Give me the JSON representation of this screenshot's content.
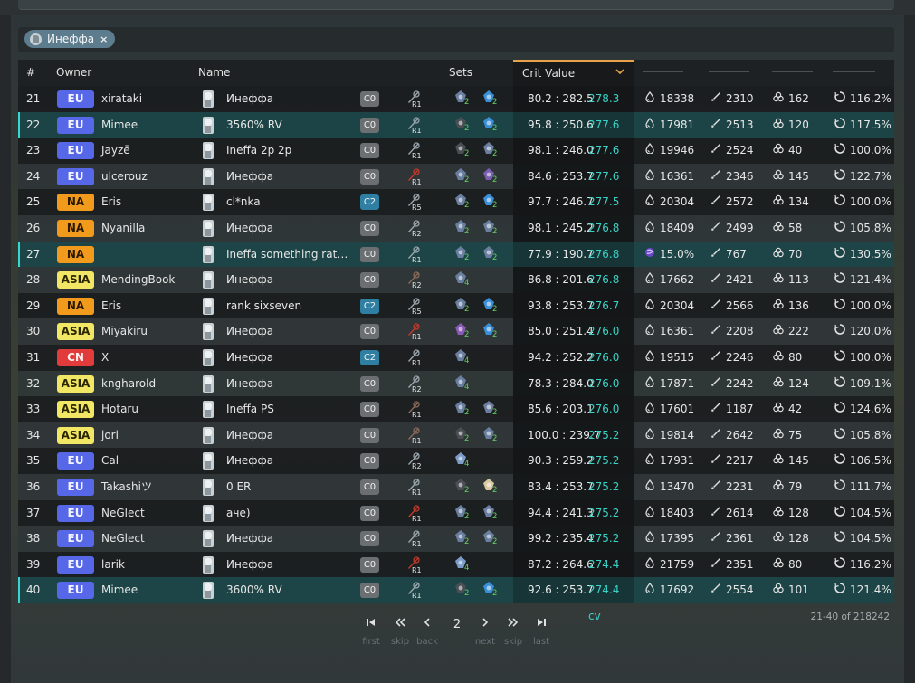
{
  "filter": {
    "chip_label": "Инеффа",
    "chip_close": "×"
  },
  "columns": {
    "rank": "#",
    "owner": "Owner",
    "name": "Name",
    "sets": "Sets",
    "crit": "Crit Value"
  },
  "rows": [
    {
      "rank": "21",
      "region": "EU",
      "owner": "xirataki",
      "name": "Инеффа",
      "cons": "C0",
      "refine": "R1",
      "wcolor": "#9aa6ad",
      "sets": [
        {
          "c": "#6a7fa0",
          "n": "2"
        },
        {
          "c": "#3a8fd8",
          "n": "2"
        }
      ],
      "ratio": "80.2 : 282.5",
      "cv": "278.3 cv",
      "s1": "18338",
      "s1icon": "hp",
      "s2": "2310",
      "s3": "162",
      "s4": "116.2%",
      "hl": false
    },
    {
      "rank": "22",
      "region": "EU",
      "owner": "Mimee",
      "name": "3560% RV",
      "cons": "C0",
      "refine": "R1",
      "wcolor": "#9aa6ad",
      "sets": [
        {
          "c": "#4b4f55",
          "n": "2"
        },
        {
          "c": "#3a8fd8",
          "n": "2"
        }
      ],
      "ratio": "95.8 : 250.6",
      "cv": "277.6 cv",
      "s1": "17981",
      "s1icon": "hp",
      "s2": "2513",
      "s3": "120",
      "s4": "117.5%",
      "hl": true
    },
    {
      "rank": "23",
      "region": "EU",
      "owner": "Jayzē",
      "name": "Ineffa 2p 2p",
      "cons": "C0",
      "refine": "R1",
      "wcolor": "#9aa6ad",
      "sets": [
        {
          "c": "#4b4f55",
          "n": "2"
        },
        {
          "c": "#6a7fa0",
          "n": "2"
        }
      ],
      "ratio": "98.1 : 246.0",
      "cv": "277.6 cv",
      "s1": "19946",
      "s1icon": "hp",
      "s2": "2524",
      "s3": "40",
      "s4": "100.0%",
      "hl": false
    },
    {
      "rank": "24",
      "region": "EU",
      "owner": "ulcerouz",
      "name": "Инеффа",
      "cons": "C0",
      "refine": "R1",
      "wcolor": "#c0392b",
      "sets": [
        {
          "c": "#6a7fa0",
          "n": "2"
        },
        {
          "c": "#7a5fb0",
          "n": "2"
        }
      ],
      "ratio": "84.6 : 253.7",
      "cv": "277.6 cv",
      "s1": "16361",
      "s1icon": "hp",
      "s2": "2346",
      "s3": "145",
      "s4": "122.7%",
      "hl": false
    },
    {
      "rank": "25",
      "region": "NA",
      "owner": "Eris",
      "name": "cl*nka",
      "cons": "C2",
      "refine": "R5",
      "wcolor": "#9aa6ad",
      "sets": [
        {
          "c": "#6a7fa0",
          "n": "2"
        },
        {
          "c": "#3a8fd8",
          "n": "2"
        }
      ],
      "ratio": "97.7 : 246.7",
      "cv": "277.5 cv",
      "s1": "20304",
      "s1icon": "hp",
      "s2": "2572",
      "s3": "134",
      "s4": "100.0%",
      "hl": false
    },
    {
      "rank": "26",
      "region": "NA",
      "owner": "Nyanilla",
      "name": "Инеффа",
      "cons": "C0",
      "refine": "R2",
      "wcolor": "#9aa6ad",
      "sets": [
        {
          "c": "#6a7fa0",
          "n": "2"
        },
        {
          "c": "#6a7fa0",
          "n": "2"
        }
      ],
      "ratio": "98.1 : 245.2",
      "cv": "276.8 cv",
      "s1": "18409",
      "s1icon": "hp",
      "s2": "2499",
      "s3": "58",
      "s4": "105.8%",
      "hl": false
    },
    {
      "rank": "27",
      "region": "NA",
      "owner": "",
      "name": "Ineffa something rather...",
      "cons": "C0",
      "refine": "R1",
      "wcolor": "#9aa6ad",
      "sets": [
        {
          "c": "#6a7fa0",
          "n": "2"
        },
        {
          "c": "#6a7fa0",
          "n": "2"
        }
      ],
      "ratio": "77.9 : 190.7",
      "cv": "276.8 cv",
      "s1": "15.0%",
      "s1icon": "electro",
      "s2": "767",
      "s3": "70",
      "s4": "130.5%",
      "hl": true
    },
    {
      "rank": "28",
      "region": "ASIA",
      "owner": "MendingBook",
      "name": "Инеффа",
      "cons": "C0",
      "refine": "R2",
      "wcolor": "#8a6a5a",
      "sets": [
        {
          "c": "#6a7fa0",
          "n": "4"
        }
      ],
      "ratio": "86.8 : 201.6",
      "cv": "276.8 cv",
      "s1": "17662",
      "s1icon": "hp",
      "s2": "2421",
      "s3": "113",
      "s4": "121.4%",
      "hl": false
    },
    {
      "rank": "29",
      "region": "NA",
      "owner": "Eris",
      "name": "rank sixseven",
      "cons": "C2",
      "refine": "R5",
      "wcolor": "#9aa6ad",
      "sets": [
        {
          "c": "#6a7fa0",
          "n": "2"
        },
        {
          "c": "#3a8fd8",
          "n": "2"
        }
      ],
      "ratio": "93.8 : 253.7",
      "cv": "276.7 cv",
      "s1": "20304",
      "s1icon": "hp",
      "s2": "2566",
      "s3": "136",
      "s4": "100.0%",
      "hl": false
    },
    {
      "rank": "30",
      "region": "ASIA",
      "owner": "Miyakiru",
      "name": "Инеффа",
      "cons": "C0",
      "refine": "R1",
      "wcolor": "#c0392b",
      "sets": [
        {
          "c": "#8a5ab8",
          "n": "2"
        },
        {
          "c": "#3a8fd8",
          "n": "2"
        }
      ],
      "ratio": "85.0 : 251.4",
      "cv": "276.0 cv",
      "s1": "16361",
      "s1icon": "hp",
      "s2": "2208",
      "s3": "222",
      "s4": "120.0%",
      "hl": false
    },
    {
      "rank": "31",
      "region": "CN",
      "owner": "X",
      "name": "Инеффа",
      "cons": "C2",
      "refine": "R1",
      "wcolor": "#9aa6ad",
      "sets": [
        {
          "c": "#6a7fa0",
          "n": "4"
        }
      ],
      "ratio": "94.2 : 252.2",
      "cv": "276.0 cv",
      "s1": "19515",
      "s1icon": "hp",
      "s2": "2246",
      "s3": "80",
      "s4": "100.0%",
      "hl": false
    },
    {
      "rank": "32",
      "region": "ASIA",
      "owner": "kngharold",
      "name": "Инеффа",
      "cons": "C0",
      "refine": "R2",
      "wcolor": "#9aa6ad",
      "sets": [
        {
          "c": "#6a7fa0",
          "n": "4"
        }
      ],
      "ratio": "78.3 : 284.0",
      "cv": "276.0 cv",
      "s1": "17871",
      "s1icon": "hp",
      "s2": "2242",
      "s3": "124",
      "s4": "109.1%",
      "hl": false
    },
    {
      "rank": "33",
      "region": "ASIA",
      "owner": "Hotaru",
      "name": "Ineffa PS",
      "cons": "C0",
      "refine": "R1",
      "wcolor": "#8a6a5a",
      "sets": [
        {
          "c": "#6a7fa0",
          "n": "2"
        },
        {
          "c": "#6a7fa0",
          "n": "2"
        }
      ],
      "ratio": "85.6 : 203.1",
      "cv": "276.0 cv",
      "s1": "17601",
      "s1icon": "hp",
      "s2": "1187",
      "s3": "42",
      "s4": "124.6%",
      "hl": false
    },
    {
      "rank": "34",
      "region": "ASIA",
      "owner": "jori",
      "name": "Инеффа",
      "cons": "C0",
      "refine": "R1",
      "wcolor": "#8a6a5a",
      "sets": [
        {
          "c": "#4b4f55",
          "n": "2"
        },
        {
          "c": "#6a7fa0",
          "n": "2"
        }
      ],
      "ratio": "100.0 : 239.7",
      "cv": "275.2 cv",
      "s1": "19814",
      "s1icon": "hp",
      "s2": "2642",
      "s3": "75",
      "s4": "105.8%",
      "hl": false
    },
    {
      "rank": "35",
      "region": "EU",
      "owner": "Cal",
      "name": "Инеффа",
      "cons": "C0",
      "refine": "R2",
      "wcolor": "#9aa6ad",
      "sets": [
        {
          "c": "#7e9cc8",
          "n": "4"
        }
      ],
      "ratio": "90.3 : 259.2",
      "cv": "275.2 cv",
      "s1": "17931",
      "s1icon": "hp",
      "s2": "2217",
      "s3": "145",
      "s4": "106.5%",
      "hl": false
    },
    {
      "rank": "36",
      "region": "EU",
      "owner": "Takashiツ",
      "name": "0 ER",
      "cons": "C0",
      "refine": "R1",
      "wcolor": "#9aa6ad",
      "sets": [
        {
          "c": "#4b4f55",
          "n": "2"
        },
        {
          "c": "#d8c8a0",
          "n": "2"
        }
      ],
      "ratio": "83.4 : 253.7",
      "cv": "275.2 cv",
      "s1": "13470",
      "s1icon": "hp",
      "s2": "2231",
      "s3": "79",
      "s4": "111.7%",
      "hl": false
    },
    {
      "rank": "37",
      "region": "EU",
      "owner": "NeGlect",
      "name": "аче)",
      "cons": "C0",
      "refine": "R1",
      "wcolor": "#c0392b",
      "sets": [
        {
          "c": "#6a7fa0",
          "n": "2"
        },
        {
          "c": "#6a7fa0",
          "n": "2"
        }
      ],
      "ratio": "94.4 : 241.3",
      "cv": "275.2 cv",
      "s1": "18403",
      "s1icon": "hp",
      "s2": "2614",
      "s3": "128",
      "s4": "104.5%",
      "hl": false
    },
    {
      "rank": "38",
      "region": "EU",
      "owner": "NeGlect",
      "name": "Инеффа",
      "cons": "C0",
      "refine": "R1",
      "wcolor": "#9aa6ad",
      "sets": [
        {
          "c": "#6a7fa0",
          "n": "2"
        },
        {
          "c": "#6a7fa0",
          "n": "2"
        }
      ],
      "ratio": "99.2 : 235.4",
      "cv": "275.2 cv",
      "s1": "17395",
      "s1icon": "hp",
      "s2": "2361",
      "s3": "128",
      "s4": "104.5%",
      "hl": false
    },
    {
      "rank": "39",
      "region": "EU",
      "owner": "larik",
      "name": "Инеффа",
      "cons": "C0",
      "refine": "R1",
      "wcolor": "#c0392b",
      "sets": [
        {
          "c": "#7e9cc8",
          "n": "4"
        }
      ],
      "ratio": "87.2 : 264.6",
      "cv": "274.4 cv",
      "s1": "21759",
      "s1icon": "hp",
      "s2": "2351",
      "s3": "80",
      "s4": "116.2%",
      "hl": false
    },
    {
      "rank": "40",
      "region": "EU",
      "owner": "Mimee",
      "name": "3600% RV",
      "cons": "C0",
      "refine": "R1",
      "wcolor": "#9aa6ad",
      "sets": [
        {
          "c": "#4b4f55",
          "n": "2"
        },
        {
          "c": "#3a8fd8",
          "n": "2"
        }
      ],
      "ratio": "92.6 : 253.7",
      "cv": "274.4 cv",
      "s1": "17692",
      "s1icon": "hp",
      "s2": "2554",
      "s3": "101",
      "s4": "121.4%",
      "hl": true
    }
  ],
  "pager": {
    "first": "first",
    "skip_back": "skip",
    "back": "back",
    "page": "2",
    "next": "next",
    "skip_fwd": "skip",
    "last": "last"
  },
  "count": "21-40 of 218242"
}
